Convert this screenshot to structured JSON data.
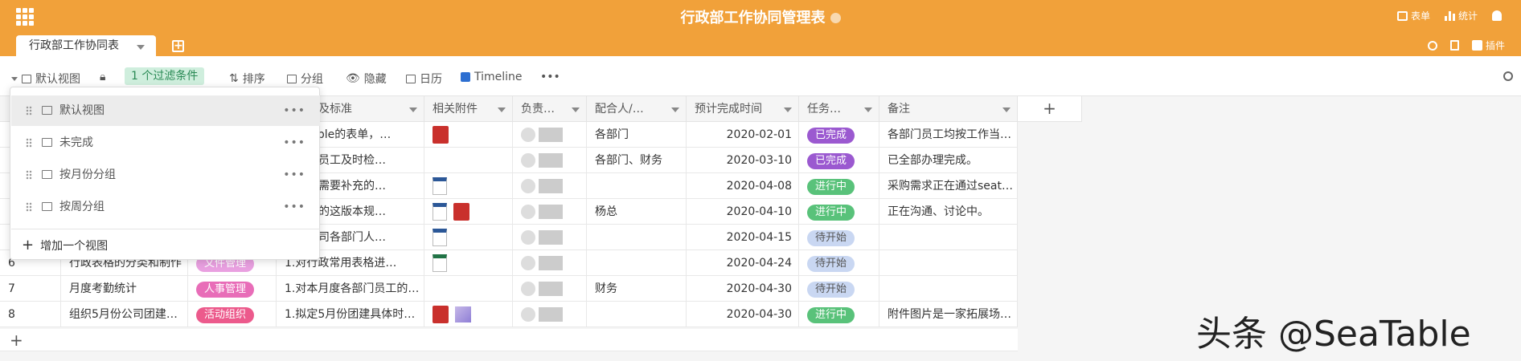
{
  "header": {
    "title": "行政部工作协同管理表",
    "form_label": "表单",
    "stats_label": "统计",
    "plugins_label": "插件"
  },
  "tabs": {
    "active": "行政部工作协同表"
  },
  "toolbar": {
    "view": "默认视图",
    "filter": "1 个过滤条件",
    "sort": "排序",
    "group": "分组",
    "hide": "隐藏",
    "calendar": "日历",
    "timeline": "Timeline",
    "more": "•••"
  },
  "views_popup": {
    "items": [
      "默认视图",
      "未完成",
      "按月份分组",
      "按周分组"
    ],
    "more": "•••",
    "add_label": "增加一个视图"
  },
  "columns": [
    "务分解及标准",
    "相关附件",
    "负责…",
    "配合人/…",
    "预计完成时间",
    "任务…",
    "备注"
  ],
  "rows": [
    {
      "num": "",
      "name": "",
      "cat": "",
      "task": "SeaTable的表单，…",
      "att": "pdf",
      "coop": "各部门",
      "date": "2020-02-01",
      "status": "已完成",
      "note": "各部门员工均按工作当…"
    },
    {
      "num": "",
      "name": "",
      "cat": "",
      "task": "各部门员工及时检…",
      "att": "",
      "coop": "各部门、财务",
      "date": "2020-03-10",
      "status": "已完成",
      "note": "已全部办理完成。"
    },
    {
      "num": "",
      "name": "",
      "cat": "",
      "task": "各部门需要补充的…",
      "att": "doc",
      "coop": "",
      "date": "2020-04-08",
      "status": "进行中",
      "note": "采购需求正在通过seat…"
    },
    {
      "num": "",
      "name": "",
      "cat": "",
      "task": "司目前的这版本规…",
      "att": "doc+pdf",
      "coop": "杨总",
      "date": "2020-04-10",
      "status": "进行中",
      "note": "正在沟通、讨论中。"
    },
    {
      "num": "",
      "name": "",
      "cat": "",
      "task": "统计公司各部门人…",
      "att": "doc",
      "coop": "",
      "date": "2020-04-15",
      "status": "待开始",
      "note": ""
    },
    {
      "num": "6",
      "name": "行政表格的分类和制作",
      "cat": "文件管理",
      "task": "1.对行政常用表格进…",
      "att": "xls",
      "coop": "",
      "date": "2020-04-24",
      "status": "待开始",
      "note": ""
    },
    {
      "num": "7",
      "name": "月度考勤统计",
      "cat": "人事管理",
      "task": "1.对本月度各部门员工的…",
      "att": "",
      "coop": "财务",
      "date": "2020-04-30",
      "status": "待开始",
      "note": ""
    },
    {
      "num": "8",
      "name": "组织5月份公司团建…",
      "cat": "活动组织",
      "task": "1.拟定5月份团建具体时…",
      "att": "pdf+img",
      "coop": "",
      "date": "2020-04-30",
      "status": "进行中",
      "note": "附件图片是一家拓展场…"
    }
  ],
  "status_colors": {
    "已完成": "#9b59d0",
    "进行中": "#59c27a",
    "待开始": "#c9d7f2"
  },
  "cat_colors": {
    "文件管理": "#e9a0e0",
    "人事管理": "#e86db8",
    "活动组织": "#ec5a8c"
  },
  "watermark": "头条 @SeaTable"
}
